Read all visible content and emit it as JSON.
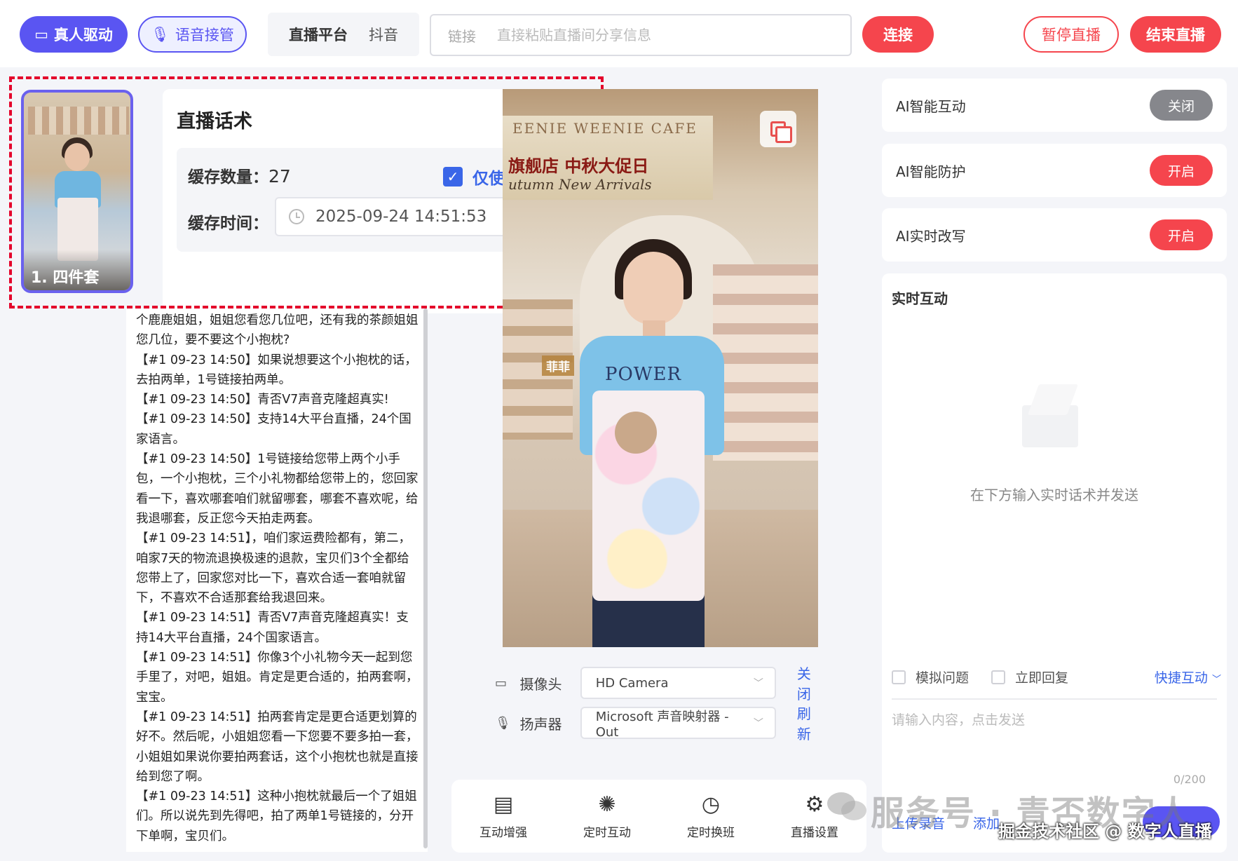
{
  "topbar": {
    "real_drive": "真人驱动",
    "voice_takeover": "语音接管",
    "platform_label": "直播平台",
    "platform_value": "抖音",
    "link_label": "链接",
    "link_placeholder": "直接粘贴直播间分享信息",
    "connect": "连接",
    "pause": "暂停直播",
    "end": "结束直播"
  },
  "thumbnail": {
    "caption": "1. 四件套"
  },
  "script": {
    "title": "直播话术",
    "cache_count_label": "缓存数量：",
    "cache_count_value": "27",
    "use_cache_only": "仅使用缓存",
    "use_cache_checked": true,
    "cache_time_label": "缓存时间：",
    "cache_time_value": "2025-09-24 14:51:53"
  },
  "log": [
    "个鹿鹿姐姐，姐姐您看您几位吧，还有我的茶颜姐姐您几位，要不要这个小抱枕?",
    "【#1 09-23 14:50】如果说想要这个小抱枕的话，去拍两单，1号链接拍两单。",
    "【#1 09-23 14:50】青否V7声音克隆超真实!",
    "【#1 09-23 14:50】支持14大平台直播，24个国家语言。",
    "【#1 09-23 14:50】1号链接给您带上两个小手包，一个小抱枕，三个小礼物都给您带上的，您回家看一下，喜欢哪套咱们就留哪套，哪套不喜欢呢，给我退哪套，反正您今天拍走两套。",
    "【#1 09-23 14:51】，咱们家运费险都有，第二，咱家7天的物流退换极速的退款，宝贝们3个全都给您带上了，回家您对比一下，喜欢合适一套咱就留下，不喜欢不合适那套给我退回来。",
    "【#1 09-23 14:51】青否V7声音克隆超真实！支持14大平台直播，24个国家语言。",
    "【#1 09-23 14:51】你像3个小礼物今天一起到您手里了，对吧，姐姐。肯定是更合适的，拍两套啊，宝宝。",
    "【#1 09-23 14:51】拍两套肯定是更合适更划算的好不。然后呢，小姐姐您看一下您要不要多拍一套，小姐姐如果说你要拍两套话，这个小抱枕也就是直接给到您了啊。",
    "【#1 09-23 14:51】这种小抱枕就最后一个了姐姐们。所以说先到先得吧，拍了两单1号链接的，分开下单啊，宝贝们。"
  ],
  "video": {
    "sign_line1": "EENIE WEENIE CAFE",
    "sign_line2": "旗舰店 中秋大促日",
    "sign_line3": "utumn New Arrivals",
    "shirt_text": "POWER",
    "badge": "菲菲"
  },
  "devices": {
    "camera_label": "摄像头",
    "camera_value": "HD Camera",
    "camera_action": "关闭",
    "speaker_label": "扬声器",
    "speaker_value": "Microsoft 声音映射器 - Out",
    "speaker_action": "刷新"
  },
  "toolbar": [
    {
      "label": "互动增强",
      "icon": "chat-icon"
    },
    {
      "label": "定时互动",
      "icon": "sparkle-icon"
    },
    {
      "label": "定时换班",
      "icon": "clock-icon"
    },
    {
      "label": "直播设置",
      "icon": "gear-icon"
    }
  ],
  "ai": [
    {
      "label": "AI智能互动",
      "state": "关闭"
    },
    {
      "label": "AI智能防护",
      "state": "开启"
    },
    {
      "label": "AI实时改写",
      "state": "开启"
    }
  ],
  "realtime": {
    "title": "实时互动",
    "empty_hint": "在下方输入实时话术并发送",
    "opt_simulate": "模拟问题",
    "opt_reply": "立即回复",
    "quick": "快捷互动",
    "input_placeholder": "请输入内容，点击发送",
    "counter": "0/200",
    "upload": "上传录音",
    "add": "添加"
  },
  "watermark": {
    "main": "服务号 · 青否数字人",
    "sub": "掘金技术社区 @ 数字人直播"
  },
  "colors": {
    "accent": "#5a55f2",
    "danger": "#f5454d",
    "link": "#3a66e8",
    "highlight_frame": "#e4002b"
  }
}
